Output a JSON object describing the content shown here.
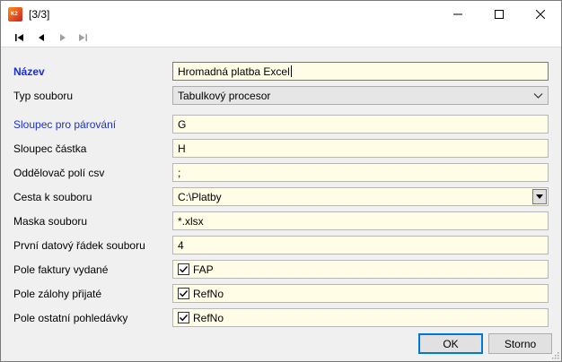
{
  "window": {
    "title": "[3/3]",
    "app_icon_text": "K2",
    "controls": {
      "minimize": "minimize",
      "maximize": "maximize",
      "close": "close"
    }
  },
  "nav": {
    "buttons": [
      {
        "icon": "first-record-icon",
        "enabled": true
      },
      {
        "icon": "previous-record-icon",
        "enabled": true
      },
      {
        "icon": "next-record-icon",
        "enabled": false
      },
      {
        "icon": "last-record-icon",
        "enabled": false
      }
    ]
  },
  "form": {
    "nazev": {
      "label": "Název",
      "value": "Hromadná platba Excel"
    },
    "typ_souboru": {
      "label": "Typ souboru",
      "value": "Tabulkový procesor"
    },
    "sloupec_parovani": {
      "label": "Sloupec pro párování",
      "value": "G"
    },
    "sloupec_castka": {
      "label": "Sloupec částka",
      "value": "H"
    },
    "oddelovac": {
      "label": "Oddělovač polí csv",
      "value": ";"
    },
    "cesta": {
      "label": "Cesta k souboru",
      "value": "C:\\Platby"
    },
    "maska": {
      "label": "Maska souboru",
      "value": "*.xlsx"
    },
    "prvni_radek": {
      "label": "První datový řádek souboru",
      "value": "4"
    },
    "faktury_vydane": {
      "label": "Pole faktury vydané",
      "checked": true,
      "value": "FAP"
    },
    "zalohy_prijate": {
      "label": "Pole zálohy přijaté",
      "checked": true,
      "value": "RefNo"
    },
    "ostatni_pohledavky": {
      "label": "Pole ostatní pohledávky",
      "checked": true,
      "value": "RefNo"
    }
  },
  "buttons": {
    "ok": "OK",
    "storno": "Storno"
  },
  "colors": {
    "field_bg": "#fffde6",
    "label_blue": "#1b2fd6",
    "focus_border": "#0078d7"
  }
}
